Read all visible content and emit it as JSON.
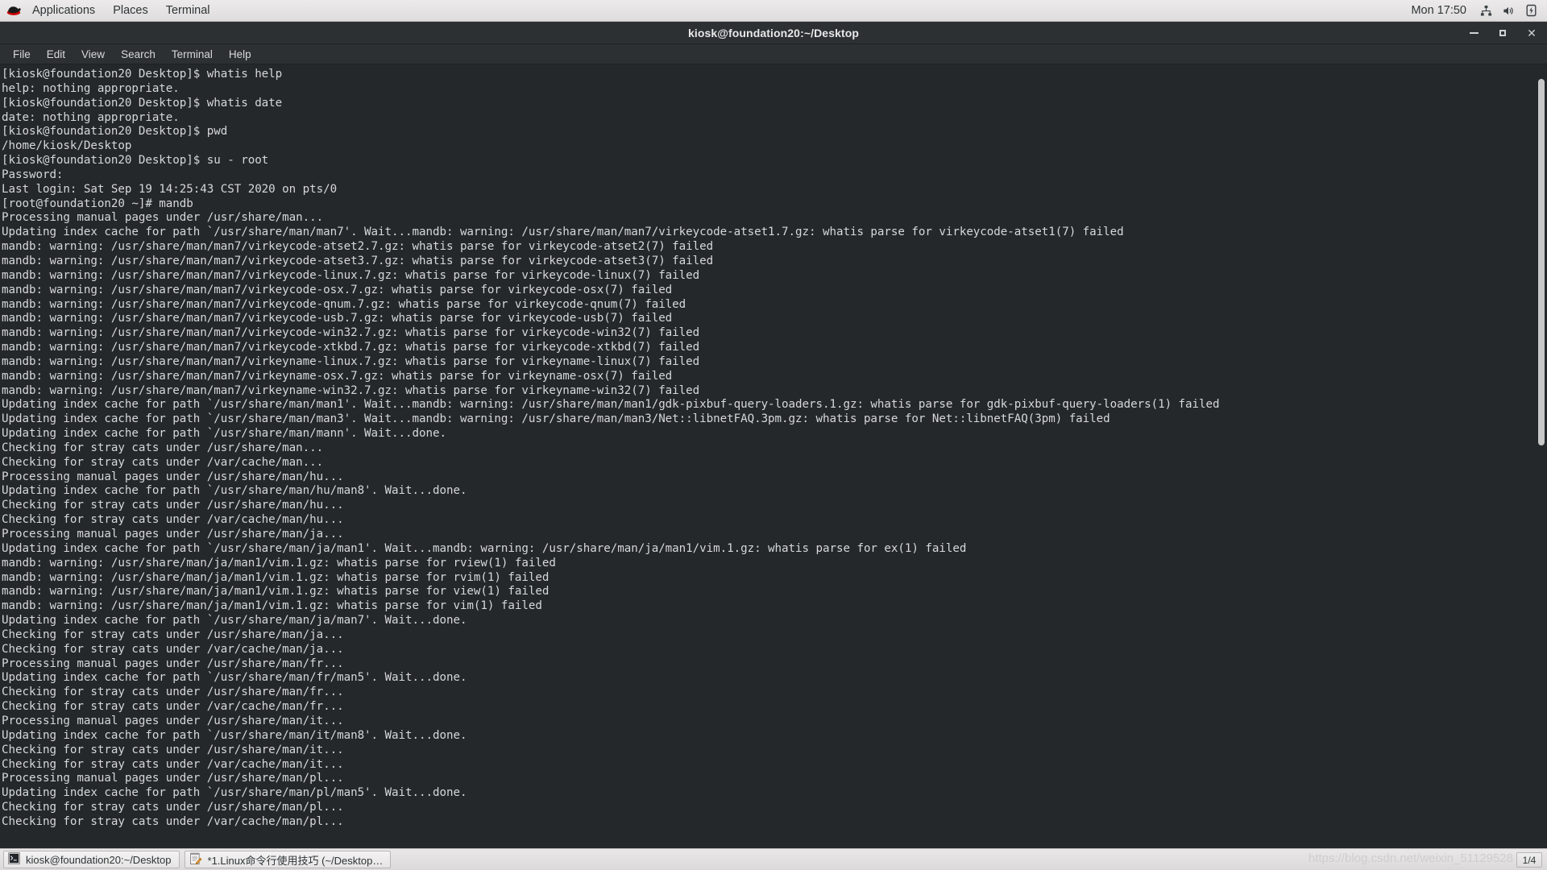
{
  "top_panel": {
    "logo_icon": "redhat-logo-icon",
    "menus": [
      {
        "label": "Applications"
      },
      {
        "label": "Places"
      },
      {
        "label": "Terminal"
      }
    ],
    "clock": "Mon 17:50",
    "tray": [
      {
        "icon": "network-icon"
      },
      {
        "icon": "volume-icon"
      },
      {
        "icon": "battery-icon"
      }
    ]
  },
  "window": {
    "title": "kiosk@foundation20:~/Desktop",
    "controls": {
      "minimize": "minimize-button",
      "maximize": "maximize-button",
      "close": "close-button",
      "close_glyph": "✕"
    },
    "menubar": [
      {
        "label": "File"
      },
      {
        "label": "Edit"
      },
      {
        "label": "View"
      },
      {
        "label": "Search"
      },
      {
        "label": "Terminal"
      },
      {
        "label": "Help"
      }
    ]
  },
  "terminal": {
    "prompt_user": "[kiosk@foundation20 Desktop]$",
    "prompt_root": "[root@foundation20 ~]#",
    "lines": [
      "[kiosk@foundation20 Desktop]$ whatis help",
      "help: nothing appropriate.",
      "[kiosk@foundation20 Desktop]$ whatis date",
      "date: nothing appropriate.",
      "[kiosk@foundation20 Desktop]$ pwd",
      "/home/kiosk/Desktop",
      "[kiosk@foundation20 Desktop]$ su - root",
      "Password:",
      "Last login: Sat Sep 19 14:25:43 CST 2020 on pts/0",
      "[root@foundation20 ~]# mandb",
      "Processing manual pages under /usr/share/man...",
      "Updating index cache for path `/usr/share/man/man7'. Wait...mandb: warning: /usr/share/man/man7/virkeycode-atset1.7.gz: whatis parse for virkeycode-atset1(7) failed",
      "mandb: warning: /usr/share/man/man7/virkeycode-atset2.7.gz: whatis parse for virkeycode-atset2(7) failed",
      "mandb: warning: /usr/share/man/man7/virkeycode-atset3.7.gz: whatis parse for virkeycode-atset3(7) failed",
      "mandb: warning: /usr/share/man/man7/virkeycode-linux.7.gz: whatis parse for virkeycode-linux(7) failed",
      "mandb: warning: /usr/share/man/man7/virkeycode-osx.7.gz: whatis parse for virkeycode-osx(7) failed",
      "mandb: warning: /usr/share/man/man7/virkeycode-qnum.7.gz: whatis parse for virkeycode-qnum(7) failed",
      "mandb: warning: /usr/share/man/man7/virkeycode-usb.7.gz: whatis parse for virkeycode-usb(7) failed",
      "mandb: warning: /usr/share/man/man7/virkeycode-win32.7.gz: whatis parse for virkeycode-win32(7) failed",
      "mandb: warning: /usr/share/man/man7/virkeycode-xtkbd.7.gz: whatis parse for virkeycode-xtkbd(7) failed",
      "mandb: warning: /usr/share/man/man7/virkeyname-linux.7.gz: whatis parse for virkeyname-linux(7) failed",
      "mandb: warning: /usr/share/man/man7/virkeyname-osx.7.gz: whatis parse for virkeyname-osx(7) failed",
      "mandb: warning: /usr/share/man/man7/virkeyname-win32.7.gz: whatis parse for virkeyname-win32(7) failed",
      "Updating index cache for path `/usr/share/man/man1'. Wait...mandb: warning: /usr/share/man/man1/gdk-pixbuf-query-loaders.1.gz: whatis parse for gdk-pixbuf-query-loaders(1) failed",
      "Updating index cache for path `/usr/share/man/man3'. Wait...mandb: warning: /usr/share/man/man3/Net::libnetFAQ.3pm.gz: whatis parse for Net::libnetFAQ(3pm) failed",
      "Updating index cache for path `/usr/share/man/mann'. Wait...done.",
      "Checking for stray cats under /usr/share/man...",
      "Checking for stray cats under /var/cache/man...",
      "Processing manual pages under /usr/share/man/hu...",
      "Updating index cache for path `/usr/share/man/hu/man8'. Wait...done.",
      "Checking for stray cats under /usr/share/man/hu...",
      "Checking for stray cats under /var/cache/man/hu...",
      "Processing manual pages under /usr/share/man/ja...",
      "Updating index cache for path `/usr/share/man/ja/man1'. Wait...mandb: warning: /usr/share/man/ja/man1/vim.1.gz: whatis parse for ex(1) failed",
      "mandb: warning: /usr/share/man/ja/man1/vim.1.gz: whatis parse for rview(1) failed",
      "mandb: warning: /usr/share/man/ja/man1/vim.1.gz: whatis parse for rvim(1) failed",
      "mandb: warning: /usr/share/man/ja/man1/vim.1.gz: whatis parse for view(1) failed",
      "mandb: warning: /usr/share/man/ja/man1/vim.1.gz: whatis parse for vim(1) failed",
      "Updating index cache for path `/usr/share/man/ja/man7'. Wait...done.",
      "Checking for stray cats under /usr/share/man/ja...",
      "Checking for stray cats under /var/cache/man/ja...",
      "Processing manual pages under /usr/share/man/fr...",
      "Updating index cache for path `/usr/share/man/fr/man5'. Wait...done.",
      "Checking for stray cats under /usr/share/man/fr...",
      "Checking for stray cats under /var/cache/man/fr...",
      "Processing manual pages under /usr/share/man/it...",
      "Updating index cache for path `/usr/share/man/it/man8'. Wait...done.",
      "Checking for stray cats under /usr/share/man/it...",
      "Checking for stray cats under /var/cache/man/it...",
      "Processing manual pages under /usr/share/man/pl...",
      "Updating index cache for path `/usr/share/man/pl/man5'. Wait...done.",
      "Checking for stray cats under /usr/share/man/pl...",
      "Checking for stray cats under /var/cache/man/pl..."
    ]
  },
  "taskbar": {
    "items": [
      {
        "icon": "terminal-icon",
        "label": "kiosk@foundation20:~/Desktop"
      },
      {
        "icon": "text-editor-icon",
        "label": "*1.Linux命令行使用技巧 (~/Desktop…"
      }
    ],
    "watermark": "https://blog.csdn.net/weixin_51129528",
    "workspace": "1/4"
  },
  "colors": {
    "terminal_bg": "#24282b",
    "terminal_fg": "#d6d8d9",
    "titlebar_bg": "#2c3033",
    "panel_bg": "#e6e4e4",
    "redhat_red": "#cc0000"
  }
}
